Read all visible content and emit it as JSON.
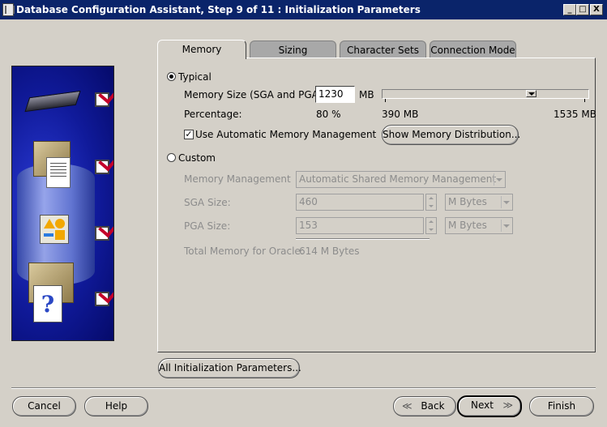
{
  "window": {
    "title": "Database Configuration Assistant, Step 9 of 11 : Initialization Parameters",
    "minimize_glyph": "_",
    "maximize_glyph": "□",
    "close_glyph": "X"
  },
  "illustration": {
    "question_glyph": "?",
    "step_icons": [
      "memory-chip-icon",
      "documents-database-icon",
      "shapes-icon",
      "question-document-icon"
    ]
  },
  "tabs": [
    {
      "label": "Memory",
      "active": true
    },
    {
      "label": "Sizing",
      "active": false
    },
    {
      "label": "Character Sets",
      "active": false
    },
    {
      "label": "Connection Mode",
      "active": false
    }
  ],
  "memory": {
    "typical": {
      "label": "Typical",
      "selected": true,
      "memory_size_label": "Memory Size (SGA and PGA):",
      "memory_size_value": "1230",
      "memory_size_unit": "MB",
      "slider_min_label": "390 MB",
      "slider_max_label": "1535 MB",
      "slider_value_mb": 1230,
      "percentage_label": "Percentage:",
      "percentage_value": "80 %",
      "amm_label": "Use Automatic Memory Management",
      "amm_checked": true,
      "show_distribution_button": "Show Memory Distribution..."
    },
    "custom": {
      "label": "Custom",
      "selected": false,
      "memory_management_label": "Memory Management",
      "memory_management_value": "Automatic Shared Memory Management",
      "sga_label": "SGA Size:",
      "sga_value": "460",
      "sga_unit": "M Bytes",
      "pga_label": "PGA Size:",
      "pga_value": "153",
      "pga_unit": "M Bytes",
      "total_label": "Total Memory for Oracle:",
      "total_value": "614 M Bytes"
    }
  },
  "all_params_button": "All Initialization Parameters...",
  "footer": {
    "cancel": "Cancel",
    "help": "Help",
    "back": "Back",
    "next": "Next",
    "finish": "Finish",
    "back_arrow": "≪",
    "next_arrow": "≫"
  },
  "colors": {
    "title_bar": "#0a246a",
    "dialog_bg": "#d4d0c8",
    "illustration_blue": "#101a9a",
    "check_red": "#c3002a"
  }
}
